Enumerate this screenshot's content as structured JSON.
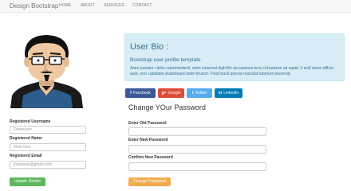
{
  "navbar": {
    "brand": "Design Bootstrap",
    "links": [
      "HOME",
      "ABOUT",
      "SERVICES",
      "CONTACT"
    ]
  },
  "profile_form": {
    "username_label": "Registered Username",
    "username_placeholder": "Demouser",
    "name_label": "Registered Name",
    "name_placeholder": "Jhon Deo",
    "email_label": "Registered Email",
    "email_placeholder": "jhondeao@gmail.com",
    "update_button": "Update Details"
  },
  "bio": {
    "title": "User Bio :",
    "subtitle": "Bootstrap user profile template",
    "text": "Anim pariatur cliche reprehenderit, enim eiusmod high life accusamus terry richardson ad squid. 3 wolf moon officia aute, non cupidatat skateboard dolor brunch. Food truck quinoa nesciunt laborum eiusmod."
  },
  "social": {
    "facebook": "Facebook",
    "google": "Google",
    "twitter": "Twitter",
    "linkedin": "LinkedIn"
  },
  "password_form": {
    "title": "Change YOur Password",
    "old_label": "Enter Old Password",
    "new_label": "Enter New Password",
    "confirm_label": "Confirm New Password",
    "change_button": "Change Password"
  },
  "colors": {
    "facebook": "#3b5998",
    "google": "#dd4b39",
    "twitter": "#55acee",
    "linkedin": "#007bb5",
    "success": "#5cb85c",
    "warning": "#f0ad4e",
    "info_bg": "#d9edf7"
  },
  "icons": {
    "facebook": "facebook-icon",
    "google": "google-plus-icon",
    "twitter": "twitter-icon",
    "linkedin": "linkedin-icon"
  }
}
